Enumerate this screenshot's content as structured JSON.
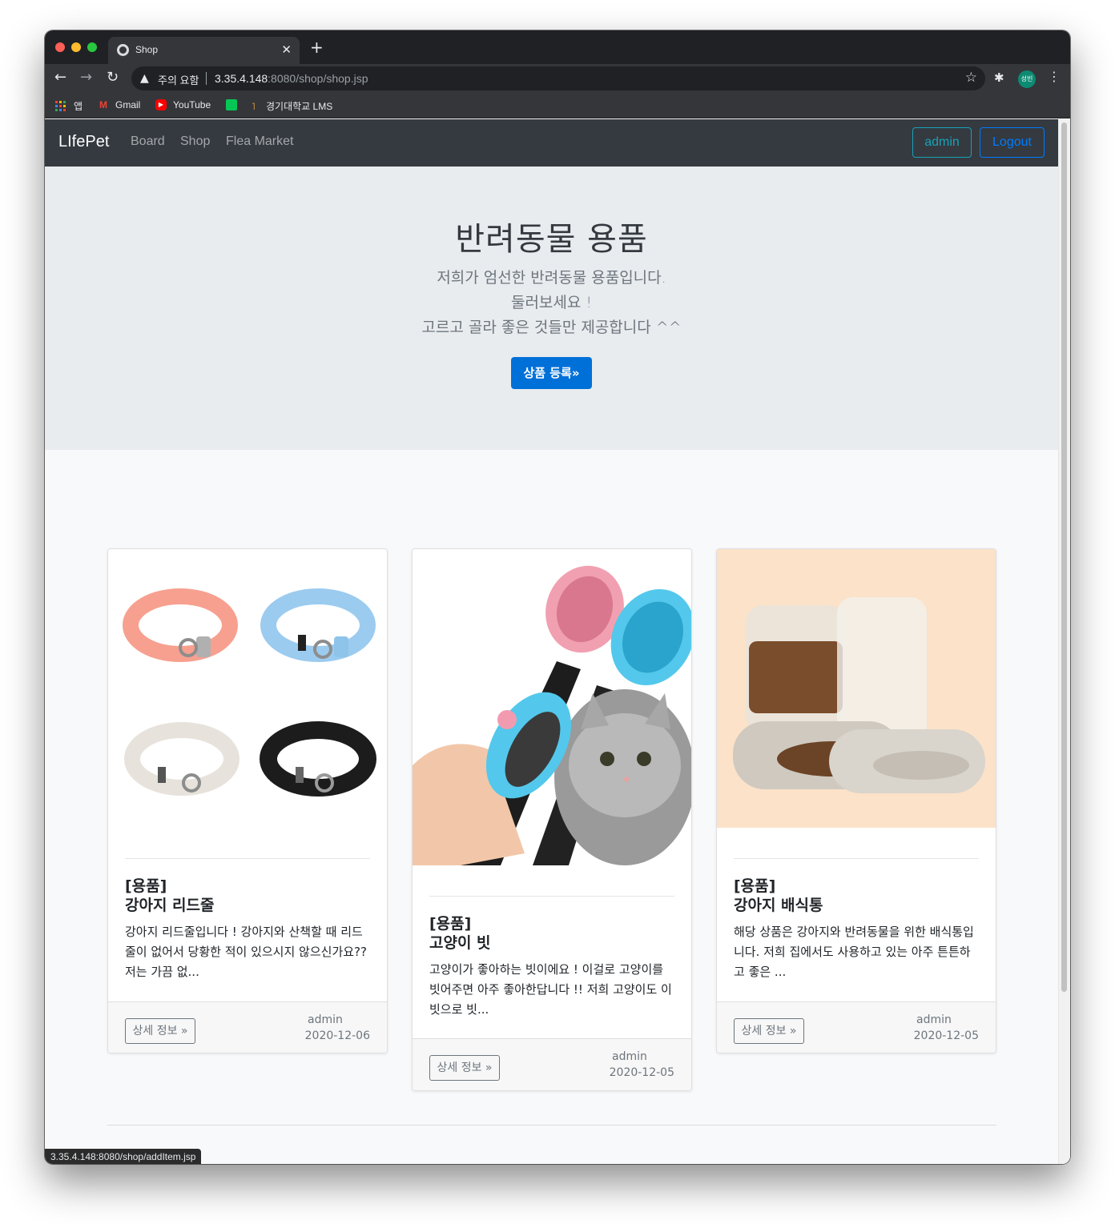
{
  "browser": {
    "tab_title": "Shop",
    "new_tab": "+",
    "security_label": "주의 요함",
    "url_host": "3.35.4.148",
    "url_rest": ":8080/shop/shop.jsp",
    "profile_initials": "성빈",
    "bookmarks": [
      {
        "label": "앱"
      },
      {
        "label": "Gmail"
      },
      {
        "label": "YouTube"
      },
      {
        "label": ""
      },
      {
        "label": "경기대학교 LMS"
      }
    ],
    "status_url": "3.35.4.148:8080/shop/addItem.jsp"
  },
  "navbar": {
    "brand": "LIfePet",
    "links": [
      "Board",
      "Shop",
      "Flea Market"
    ],
    "admin_label": "admin",
    "logout_label": "Logout"
  },
  "jumbotron": {
    "title": "반려동물 용품",
    "lines": [
      "저희가 엄선한 반려동물 용품입니다.",
      "둘러보세요 !",
      "고르고 골라 좋은 것들만 제공합니다 ^^"
    ],
    "register_button": "상품 등록»"
  },
  "products": [
    {
      "category": "[용품]",
      "name": "강아지 리드줄",
      "description": "강아지 리드줄입니다 ! 강아지와 산책할 때 리드줄이 없어서 당황한 적이 있으시지 않으신가요?? 저는 가끔 없...",
      "detail_button": "상세 정보 »",
      "author": "admin",
      "date": "2020-12-06"
    },
    {
      "category": "[용품]",
      "name": "고양이 빗",
      "description": "고양이가 좋아하는 빗이에요 ! 이걸로 고양이를 빗어주면 아주 좋아한답니다 !! 저희 고양이도 이 빗으로 빗...",
      "detail_button": "상세 정보 »",
      "author": "admin",
      "date": "2020-12-05"
    },
    {
      "category": "[용품]",
      "name": "강아지 배식통",
      "description": "해당 상품은 강아지와 반려동물을 위한 배식통입 니다. 저희 집에서도 사용하고 있는 아주 튼튼하고 좋은 ...",
      "detail_button": "상세 정보 »",
      "author": "admin",
      "date": "2020-12-05"
    }
  ]
}
